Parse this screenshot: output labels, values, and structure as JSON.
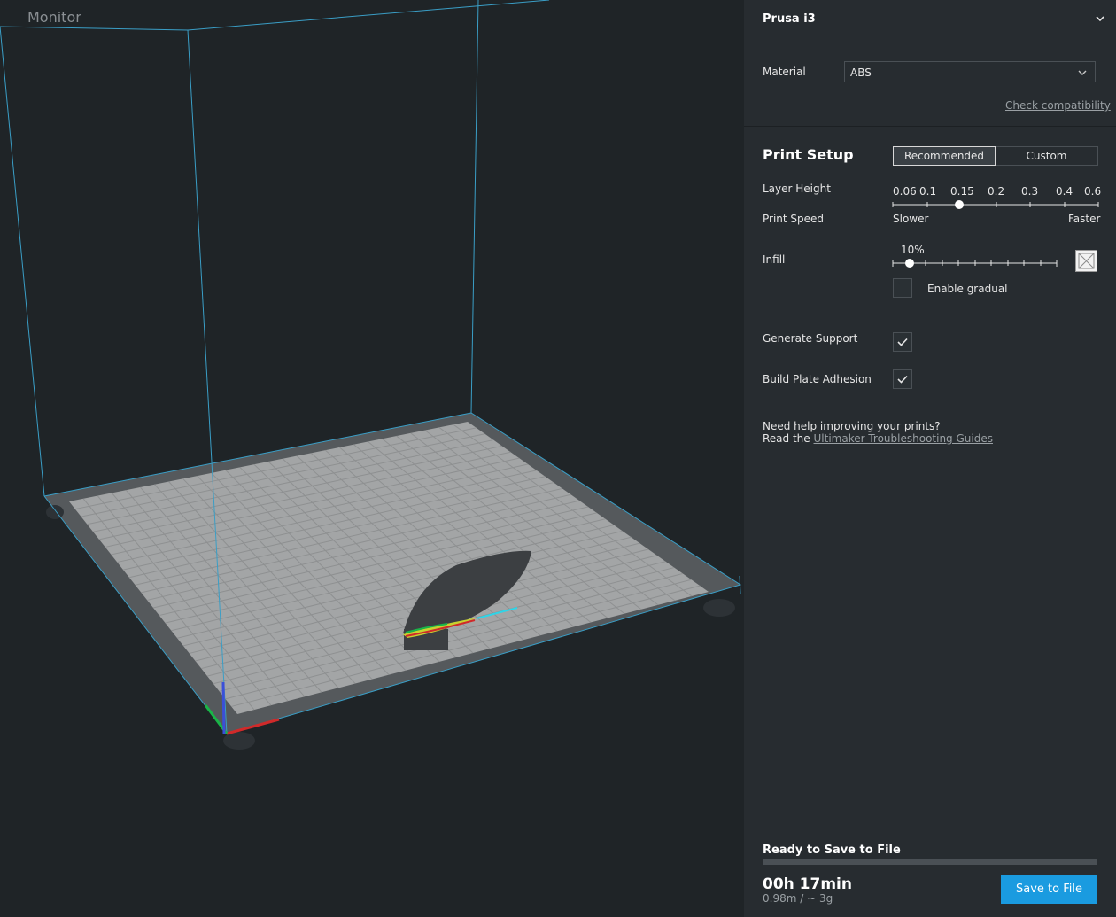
{
  "viewport": {
    "stage_label": "Monitor"
  },
  "printer": {
    "name": "Prusa i3"
  },
  "material": {
    "label": "Material",
    "value": "ABS",
    "compat_link": "Check compatibility"
  },
  "print_setup": {
    "title": "Print Setup",
    "tabs": {
      "recommended": "Recommended",
      "custom": "Custom"
    },
    "layer_height": {
      "label": "Layer Height",
      "ticks": [
        "0.06",
        "0.1",
        "0.15",
        "0.2",
        "0.3",
        "0.4",
        "0.6"
      ],
      "selected": "0.15"
    },
    "print_speed": {
      "label": "Print Speed",
      "slower": "Slower",
      "faster": "Faster"
    },
    "infill": {
      "label": "Infill",
      "value": "10%",
      "gradual_label": "Enable gradual"
    },
    "generate_support": {
      "label": "Generate Support",
      "checked": true
    },
    "adhesion": {
      "label": "Build Plate Adhesion",
      "checked": true
    },
    "help": {
      "line1": "Need help improving your prints?",
      "line2_prefix": "Read the",
      "link": "Ultimaker Troubleshooting Guides"
    }
  },
  "status": {
    "title": "Ready to Save to File",
    "time": "00h 17min",
    "amount": "0.98m / ~ 3g",
    "save_button": "Save to File"
  },
  "colors": {
    "accent": "#1a9be0",
    "build_volume_edge": "#3a9ec6",
    "background": "#1f2427"
  }
}
